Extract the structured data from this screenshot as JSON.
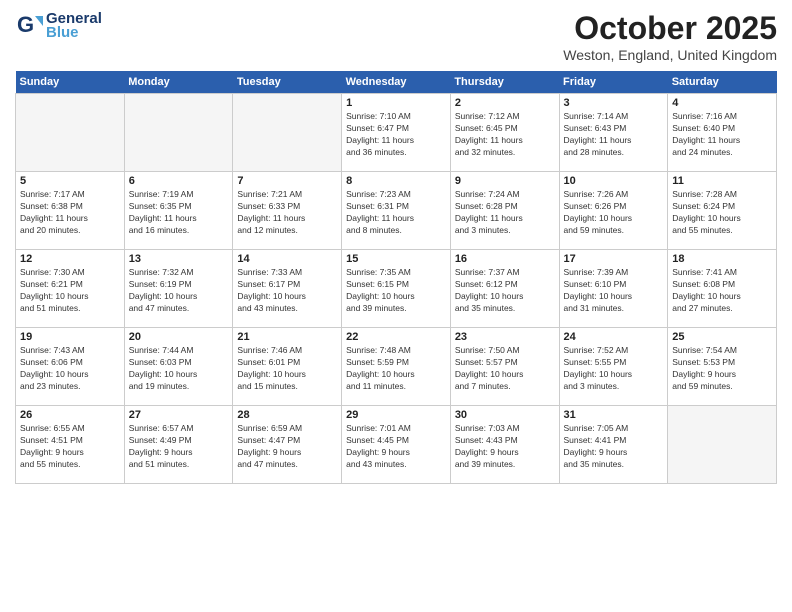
{
  "header": {
    "logo_line1": "General",
    "logo_line2": "Blue",
    "month": "October 2025",
    "location": "Weston, England, United Kingdom"
  },
  "weekdays": [
    "Sunday",
    "Monday",
    "Tuesday",
    "Wednesday",
    "Thursday",
    "Friday",
    "Saturday"
  ],
  "weeks": [
    [
      {
        "day": "",
        "info": "",
        "empty": true
      },
      {
        "day": "",
        "info": "",
        "empty": true
      },
      {
        "day": "",
        "info": "",
        "empty": true
      },
      {
        "day": "1",
        "info": "Sunrise: 7:10 AM\nSunset: 6:47 PM\nDaylight: 11 hours\nand 36 minutes."
      },
      {
        "day": "2",
        "info": "Sunrise: 7:12 AM\nSunset: 6:45 PM\nDaylight: 11 hours\nand 32 minutes."
      },
      {
        "day": "3",
        "info": "Sunrise: 7:14 AM\nSunset: 6:43 PM\nDaylight: 11 hours\nand 28 minutes."
      },
      {
        "day": "4",
        "info": "Sunrise: 7:16 AM\nSunset: 6:40 PM\nDaylight: 11 hours\nand 24 minutes."
      }
    ],
    [
      {
        "day": "5",
        "info": "Sunrise: 7:17 AM\nSunset: 6:38 PM\nDaylight: 11 hours\nand 20 minutes."
      },
      {
        "day": "6",
        "info": "Sunrise: 7:19 AM\nSunset: 6:35 PM\nDaylight: 11 hours\nand 16 minutes."
      },
      {
        "day": "7",
        "info": "Sunrise: 7:21 AM\nSunset: 6:33 PM\nDaylight: 11 hours\nand 12 minutes."
      },
      {
        "day": "8",
        "info": "Sunrise: 7:23 AM\nSunset: 6:31 PM\nDaylight: 11 hours\nand 8 minutes."
      },
      {
        "day": "9",
        "info": "Sunrise: 7:24 AM\nSunset: 6:28 PM\nDaylight: 11 hours\nand 3 minutes."
      },
      {
        "day": "10",
        "info": "Sunrise: 7:26 AM\nSunset: 6:26 PM\nDaylight: 10 hours\nand 59 minutes."
      },
      {
        "day": "11",
        "info": "Sunrise: 7:28 AM\nSunset: 6:24 PM\nDaylight: 10 hours\nand 55 minutes."
      }
    ],
    [
      {
        "day": "12",
        "info": "Sunrise: 7:30 AM\nSunset: 6:21 PM\nDaylight: 10 hours\nand 51 minutes."
      },
      {
        "day": "13",
        "info": "Sunrise: 7:32 AM\nSunset: 6:19 PM\nDaylight: 10 hours\nand 47 minutes."
      },
      {
        "day": "14",
        "info": "Sunrise: 7:33 AM\nSunset: 6:17 PM\nDaylight: 10 hours\nand 43 minutes."
      },
      {
        "day": "15",
        "info": "Sunrise: 7:35 AM\nSunset: 6:15 PM\nDaylight: 10 hours\nand 39 minutes."
      },
      {
        "day": "16",
        "info": "Sunrise: 7:37 AM\nSunset: 6:12 PM\nDaylight: 10 hours\nand 35 minutes."
      },
      {
        "day": "17",
        "info": "Sunrise: 7:39 AM\nSunset: 6:10 PM\nDaylight: 10 hours\nand 31 minutes."
      },
      {
        "day": "18",
        "info": "Sunrise: 7:41 AM\nSunset: 6:08 PM\nDaylight: 10 hours\nand 27 minutes."
      }
    ],
    [
      {
        "day": "19",
        "info": "Sunrise: 7:43 AM\nSunset: 6:06 PM\nDaylight: 10 hours\nand 23 minutes."
      },
      {
        "day": "20",
        "info": "Sunrise: 7:44 AM\nSunset: 6:03 PM\nDaylight: 10 hours\nand 19 minutes."
      },
      {
        "day": "21",
        "info": "Sunrise: 7:46 AM\nSunset: 6:01 PM\nDaylight: 10 hours\nand 15 minutes."
      },
      {
        "day": "22",
        "info": "Sunrise: 7:48 AM\nSunset: 5:59 PM\nDaylight: 10 hours\nand 11 minutes."
      },
      {
        "day": "23",
        "info": "Sunrise: 7:50 AM\nSunset: 5:57 PM\nDaylight: 10 hours\nand 7 minutes."
      },
      {
        "day": "24",
        "info": "Sunrise: 7:52 AM\nSunset: 5:55 PM\nDaylight: 10 hours\nand 3 minutes."
      },
      {
        "day": "25",
        "info": "Sunrise: 7:54 AM\nSunset: 5:53 PM\nDaylight: 9 hours\nand 59 minutes."
      }
    ],
    [
      {
        "day": "26",
        "info": "Sunrise: 6:55 AM\nSunset: 4:51 PM\nDaylight: 9 hours\nand 55 minutes."
      },
      {
        "day": "27",
        "info": "Sunrise: 6:57 AM\nSunset: 4:49 PM\nDaylight: 9 hours\nand 51 minutes."
      },
      {
        "day": "28",
        "info": "Sunrise: 6:59 AM\nSunset: 4:47 PM\nDaylight: 9 hours\nand 47 minutes."
      },
      {
        "day": "29",
        "info": "Sunrise: 7:01 AM\nSunset: 4:45 PM\nDaylight: 9 hours\nand 43 minutes."
      },
      {
        "day": "30",
        "info": "Sunrise: 7:03 AM\nSunset: 4:43 PM\nDaylight: 9 hours\nand 39 minutes."
      },
      {
        "day": "31",
        "info": "Sunrise: 7:05 AM\nSunset: 4:41 PM\nDaylight: 9 hours\nand 35 minutes."
      },
      {
        "day": "",
        "info": "",
        "empty": true
      }
    ]
  ]
}
